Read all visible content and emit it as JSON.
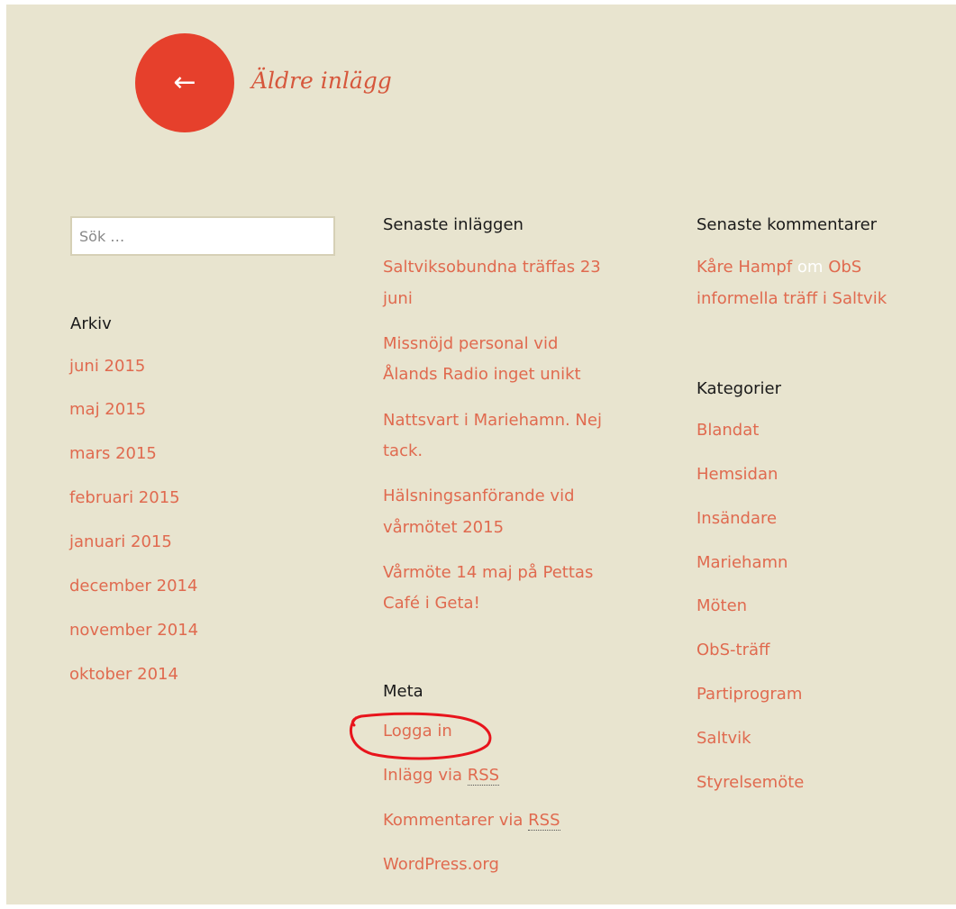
{
  "pagination": {
    "arrow": "←",
    "label": "Äldre inlägg"
  },
  "search": {
    "placeholder": "Sök …"
  },
  "archive": {
    "title": "Arkiv",
    "items": [
      "juni 2015",
      "maj 2015",
      "mars 2015",
      "februari 2015",
      "januari 2015",
      "december 2014",
      "november 2014",
      "oktober 2014"
    ]
  },
  "recent_posts": {
    "title": "Senaste inläggen",
    "items": [
      {
        "line1": "Saltviksobundna träffas 23",
        "line2": "juni"
      },
      {
        "line1": "Missnöjd personal vid",
        "line2": "Ålands Radio inget unikt"
      },
      {
        "line1": "Nattsvart i Mariehamn. Nej",
        "line2": "tack."
      },
      {
        "line1": "Hälsningsanförande vid",
        "line2": "vårmötet 2015"
      },
      {
        "line1": "Vårmöte 14 maj på Pettas",
        "line2": "Café i Geta!"
      }
    ]
  },
  "meta": {
    "title": "Meta",
    "login": "Logga in",
    "entries_prefix": "Inlägg via ",
    "comments_prefix": "Kommentarer via ",
    "rss": "RSS",
    "wordpress": "WordPress.org"
  },
  "recent_comments": {
    "title": "Senaste kommentarer",
    "author": "Kåre Hampf",
    "on": "om",
    "post_part1": "ObS",
    "post_part2": "informella träff i Saltvik"
  },
  "categories": {
    "title": "Kategorier",
    "items": [
      "Blandat",
      "Hemsidan",
      "Insändare",
      "Mariehamn",
      "Möten",
      "ObS-träff",
      "Partiprogram",
      "Saltvik",
      "Styrelsemöte"
    ]
  },
  "colors": {
    "background": "#e8e4cf",
    "accent": "#e6402c",
    "link": "#e06a4f",
    "annotation": "#e8141c"
  }
}
